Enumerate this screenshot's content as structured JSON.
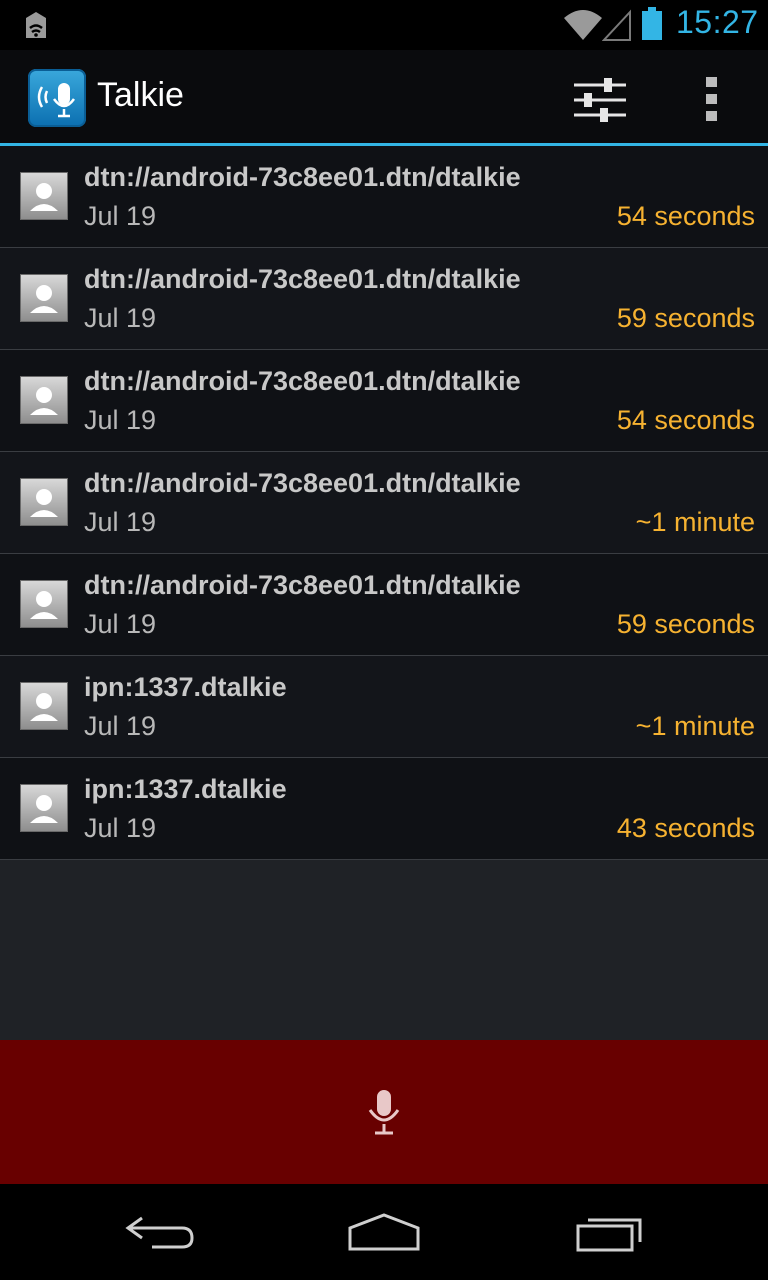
{
  "status_bar": {
    "time": "15:27",
    "icons": [
      "notification-icon",
      "wifi-icon",
      "signal-icon",
      "battery-icon"
    ],
    "accent_color": "#33b5e5"
  },
  "action_bar": {
    "title": "Talkie",
    "icons": [
      "app-logo-icon",
      "settings-sliders-icon",
      "overflow-menu-icon"
    ]
  },
  "recordings": [
    {
      "title": "dtn://android-73c8ee01.dtn/dtalkie",
      "date": "Jul 19",
      "duration": "54 seconds"
    },
    {
      "title": "dtn://android-73c8ee01.dtn/dtalkie",
      "date": "Jul 19",
      "duration": "59 seconds"
    },
    {
      "title": "dtn://android-73c8ee01.dtn/dtalkie",
      "date": "Jul 19",
      "duration": "54 seconds"
    },
    {
      "title": "dtn://android-73c8ee01.dtn/dtalkie",
      "date": "Jul 19",
      "duration": "~1 minute"
    },
    {
      "title": "dtn://android-73c8ee01.dtn/dtalkie",
      "date": "Jul 19",
      "duration": "59 seconds"
    },
    {
      "title": "ipn:1337.dtalkie",
      "date": "Jul 19",
      "duration": "~1 minute"
    },
    {
      "title": "ipn:1337.dtalkie",
      "date": "Jul 19",
      "duration": "43 seconds"
    }
  ],
  "record_bar": {
    "icon": "microphone-icon",
    "background_color": "#680000"
  },
  "nav_bar": {
    "icons": [
      "back-icon",
      "home-icon",
      "recents-icon"
    ]
  },
  "colors": {
    "duration": "#f6b231",
    "background": "#1f2226"
  }
}
